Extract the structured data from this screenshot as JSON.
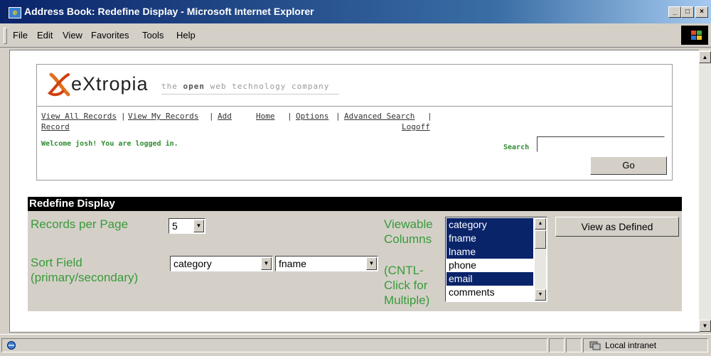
{
  "window": {
    "title": "Address Book: Redefine Display - Microsoft Internet Explorer",
    "icon": "ie-icon",
    "controls": [
      "_",
      "□",
      "×"
    ]
  },
  "menu": [
    "File",
    "Edit",
    "View",
    "Favorites",
    "Tools",
    "Help"
  ],
  "header": {
    "logo_text": "eXtropia",
    "tagline_pre": "the ",
    "tagline_bold": "open",
    "tagline_post": " web technology company",
    "nav": {
      "view_all": "View All Records",
      "sep1": "|",
      "view_my": "View My Records",
      "sep2": "|",
      "add": "Add",
      "record": "Record",
      "home": "Home",
      "sep3": "|",
      "options": "Options",
      "sep4": "|",
      "advanced_search": "Advanced Search",
      "sep5": "|",
      "logoff": "Logoff"
    },
    "welcome": "Welcome josh! You are logged in.",
    "search_label": "Search",
    "search_value": "",
    "go_label": "Go"
  },
  "panel": {
    "title": "Redefine Display",
    "records_per_page_label": "Records per Page",
    "records_per_page_value": "5",
    "sort_field_label_1": "Sort Field",
    "sort_field_label_2": "(primary/secondary)",
    "sort_primary": "category",
    "sort_secondary": "fname",
    "viewable_label_1": "Viewable",
    "viewable_label_2": "Columns",
    "cntl_label_1": "(CNTL-",
    "cntl_label_2": "Click for",
    "cntl_label_3": "Multiple)",
    "columns": [
      {
        "label": "category",
        "selected": true
      },
      {
        "label": "fname",
        "selected": true
      },
      {
        "label": "lname",
        "selected": true
      },
      {
        "label": "phone",
        "selected": false
      },
      {
        "label": "email",
        "selected": true
      },
      {
        "label": "comments",
        "selected": false
      }
    ],
    "view_button": "View as Defined"
  },
  "status": {
    "zone": "Local intranet"
  },
  "colors": {
    "accent_green": "#3a9a3a",
    "selection": "#0a246a",
    "title_bar": "#0a246a"
  }
}
